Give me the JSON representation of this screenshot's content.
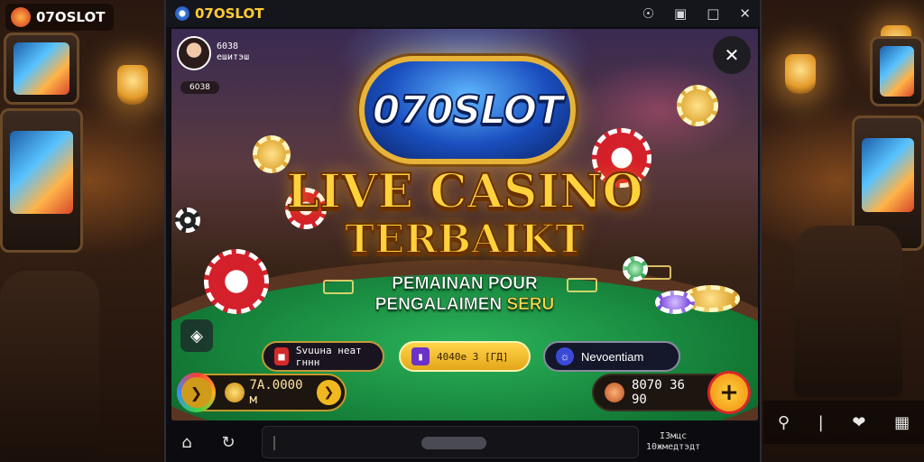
{
  "app": {
    "corner_logo": "07OSLOT",
    "window_title": "07OSLOT"
  },
  "titlebar": {
    "icons": [
      "support-icon",
      "camera-icon",
      "maximize-icon",
      "close-icon"
    ]
  },
  "profile": {
    "name_line1": "6038",
    "name_line2": "ешитэш",
    "level": "6038"
  },
  "banner": {
    "logo_text": "070SLOT",
    "headline_1": "LIVE CASINO",
    "headline_2": "TERBAIKT",
    "sub_1": "PEMAINAN POUR",
    "sub_2_a": "PENGALAIMEN ",
    "sub_2_b": "SERU"
  },
  "actions": {
    "pill_1": "Svuuна неат гннн",
    "pill_2": "4040е 3 [ГД]",
    "pill_3": "Nevoentiam"
  },
  "wallet": {
    "balance_left": "7А.0000 м",
    "balance_right": "8070 36 90"
  },
  "footer": {
    "line1": "I3мцс",
    "line2": "10жмедтэдт"
  },
  "colors": {
    "accent_gold": "#ffd23c",
    "table_green": "#137a36",
    "logo_blue": "#1a4fbf"
  }
}
